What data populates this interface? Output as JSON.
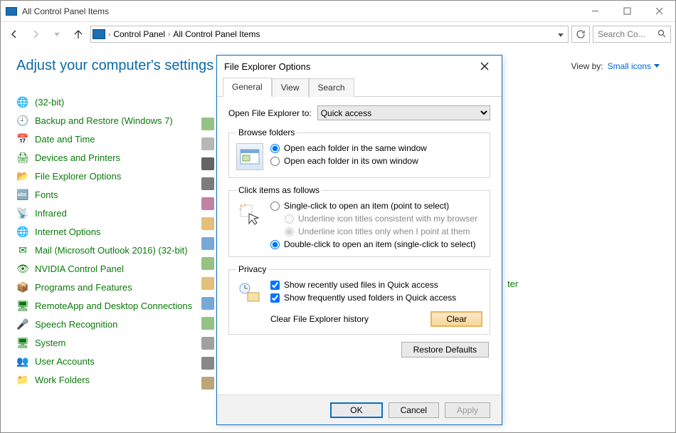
{
  "window": {
    "title": "All Control Panel Items"
  },
  "breadcrumbs": {
    "item0": "Control Panel",
    "item1": "All Control Panel Items"
  },
  "search": {
    "placeholder": "Search Co..."
  },
  "header": {
    "title": "Adjust your computer's settings",
    "viewby_label": "View by:",
    "viewby_value": "Small icons"
  },
  "cp_items": [
    {
      "label": "(32-bit)",
      "icon": "🌐"
    },
    {
      "label": "Backup and Restore (Windows 7)",
      "icon": "🕘"
    },
    {
      "label": "Date and Time",
      "icon": "📅"
    },
    {
      "label": "Devices and Printers",
      "icon": "🖨"
    },
    {
      "label": "File Explorer Options",
      "icon": "📂"
    },
    {
      "label": "Fonts",
      "icon": "🔤"
    },
    {
      "label": "Infrared",
      "icon": "📡"
    },
    {
      "label": "Internet Options",
      "icon": "🌐"
    },
    {
      "label": "Mail (Microsoft Outlook 2016) (32-bit)",
      "icon": "✉"
    },
    {
      "label": "NVIDIA Control Panel",
      "icon": "👁"
    },
    {
      "label": "Programs and Features",
      "icon": "📦"
    },
    {
      "label": "RemoteApp and Desktop Connections",
      "icon": "🖥"
    },
    {
      "label": "Speech Recognition",
      "icon": "🎤"
    },
    {
      "label": "System",
      "icon": "🖥"
    },
    {
      "label": "User Accounts",
      "icon": "👥"
    },
    {
      "label": "Work Folders",
      "icon": "📁"
    }
  ],
  "right_fragment": "ter",
  "dialog": {
    "title": "File Explorer Options",
    "tabs": {
      "general": "General",
      "view": "View",
      "search": "Search"
    },
    "open_to_label": "Open File Explorer to:",
    "open_to_value": "Quick access",
    "group_browse": {
      "legend": "Browse folders",
      "opt_same": "Open each folder in the same window",
      "opt_own": "Open each folder in its own window"
    },
    "group_click": {
      "legend": "Click items as follows",
      "opt_single": "Single-click to open an item (point to select)",
      "opt_underline_browser": "Underline icon titles consistent with my browser",
      "opt_underline_point": "Underline icon titles only when I point at them",
      "opt_double": "Double-click to open an item (single-click to select)"
    },
    "group_privacy": {
      "legend": "Privacy",
      "chk_recent": "Show recently used files in Quick access",
      "chk_frequent": "Show frequently used folders in Quick access",
      "clear_label": "Clear File Explorer history",
      "clear_btn": "Clear"
    },
    "restore_btn": "Restore Defaults",
    "ok": "OK",
    "cancel": "Cancel",
    "apply": "Apply"
  }
}
